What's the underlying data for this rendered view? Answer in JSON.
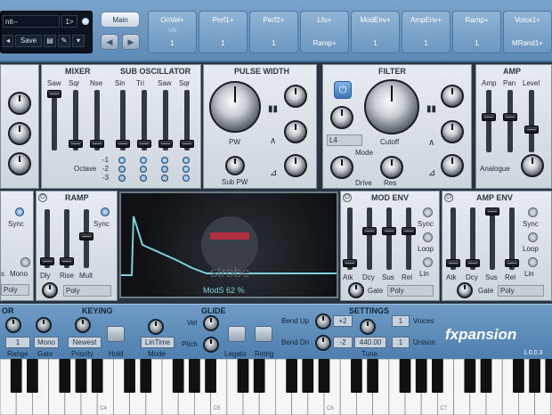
{
  "header": {
    "preset_name": "nit--",
    "preset_num": "1>",
    "save_label": "Save",
    "main_label": "Main",
    "nav_prev": "◀",
    "nav_next": "▶"
  },
  "mod_slots": [
    {
      "line1": "OnVel+",
      "line2": "Vib",
      "line3": "1"
    },
    {
      "line1": "Perf1+",
      "line2": "",
      "line3": "1"
    },
    {
      "line1": "Perf2+",
      "line2": "",
      "line3": "1"
    },
    {
      "line1": "Lfo+",
      "line2": "",
      "line3": "Ramp+"
    },
    {
      "line1": "ModEnv+",
      "line2": "",
      "line3": "1"
    },
    {
      "line1": "AmpEnv+",
      "line2": "",
      "line3": "1"
    },
    {
      "line1": "Ramp+",
      "line2": "",
      "line3": "1"
    },
    {
      "line1": "Voice1+",
      "line2": "",
      "line3": "MRand1+"
    }
  ],
  "mixer": {
    "title": "MIXER",
    "labels": [
      "Saw",
      "Sqr",
      "Nse"
    ]
  },
  "sub_osc": {
    "title": "SUB OSCILLATOR",
    "labels": [
      "Sin",
      "Tri",
      "Saw",
      "Sqr"
    ],
    "octave_label": "Octave",
    "octaves": [
      "-1",
      "-2",
      "-3"
    ]
  },
  "pulse_width": {
    "title": "PULSE WIDTH",
    "pw_label": "PW",
    "subpw_label": "Sub PW"
  },
  "filter": {
    "title": "FILTER",
    "mode_value": "L4",
    "mode_label": "Mode",
    "cutoff_label": "Cutoff",
    "drive_label": "Drive",
    "res_label": "Res"
  },
  "amp": {
    "title": "AMP",
    "labels": [
      "Amp",
      "Pan",
      "Level"
    ],
    "analogue_label": "Analogue"
  },
  "lfo_left": {
    "sync_label": "Sync",
    "s_label": "s",
    "mono_label": "Mono",
    "poly_value": "Poly"
  },
  "ramp": {
    "title": "RAMP",
    "sync_label": "Sync",
    "labels": [
      "Dly",
      "Rise",
      "Mult"
    ],
    "poly_value": "Poly"
  },
  "scope": {
    "readout": "ModS 62 %",
    "logo_text": "strobe"
  },
  "mod_env": {
    "title": "MOD ENV",
    "labels": [
      "Atk",
      "Dcy",
      "Sus",
      "Rel"
    ],
    "side": [
      "Sync",
      "Loop",
      "Lin"
    ],
    "gate_label": "Gate",
    "poly_value": "Poly"
  },
  "amp_env": {
    "title": "AMP ENV",
    "labels": [
      "Atk",
      "Dcy",
      "Sus",
      "Rel"
    ],
    "side": [
      "Sync",
      "Loop",
      "Lin"
    ],
    "gate_label": "Gate",
    "poly_value": "Poly"
  },
  "bottom": {
    "arp_title": "OR",
    "arp_value1": "1",
    "arp_value2": "Mono",
    "range_label": "Range",
    "gate_label": "Gate",
    "keying_title": "KEYING",
    "priority_value": "Newest",
    "priority_label": "Priority",
    "hold_label": "Hold",
    "glide_title": "GLIDE",
    "vel_label": "Vel",
    "pitch_label": "Pitch",
    "mode_value": "LinTime",
    "mode_label": "Mode",
    "legato_label": "Legato",
    "retrig_label": "Retrig",
    "settings_title": "SETTINGS",
    "bendup_label": "Bend Up",
    "bendup_value": "+2",
    "benddn_label": "Bend Dn",
    "benddn_value": "-2",
    "tune_value": "440.00",
    "tune_label": "Tune",
    "voices_value": "1",
    "voices_label": "Voices",
    "unison_value": "1",
    "unison_label": "Unison",
    "brand": "fxpansion",
    "version": "1.0.0.3"
  },
  "keyboard": {
    "labels": [
      "C4",
      "C5",
      "C6",
      "C7"
    ]
  },
  "colors": {
    "accent": "#5d8ab7",
    "scope_trace": "#7fd1dc"
  }
}
